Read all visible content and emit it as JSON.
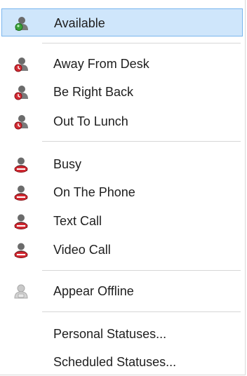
{
  "menu": {
    "items": [
      {
        "label": "Available",
        "icon": "presence-available-icon",
        "color": "#2f8f2f",
        "selected": true
      },
      {
        "label": "Away From Desk",
        "icon": "presence-away-icon",
        "color": "#c0202a"
      },
      {
        "label": "Be Right Back",
        "icon": "presence-be-right-back-icon",
        "color": "#c0202a"
      },
      {
        "label": "Out To Lunch",
        "icon": "presence-out-to-lunch-icon",
        "color": "#c0202a"
      },
      {
        "label": "Busy",
        "icon": "presence-busy-icon",
        "color": "#c0202a"
      },
      {
        "label": "On The Phone",
        "icon": "presence-on-the-phone-icon",
        "color": "#c0202a"
      },
      {
        "label": "Text Call",
        "icon": "presence-text-call-icon",
        "color": "#c0202a"
      },
      {
        "label": "Video Call",
        "icon": "presence-video-call-icon",
        "color": "#c0202a"
      },
      {
        "label": "Appear Offline",
        "icon": "presence-offline-icon",
        "color": "#b8b8b8"
      },
      {
        "label": "Personal Statuses..."
      },
      {
        "label": "Scheduled Statuses..."
      }
    ]
  },
  "colors": {
    "selection_bg": "#cfe6fb",
    "selection_border": "#7ab6ee",
    "separator": "#d7d7d7",
    "text": "#1e1e1e"
  }
}
